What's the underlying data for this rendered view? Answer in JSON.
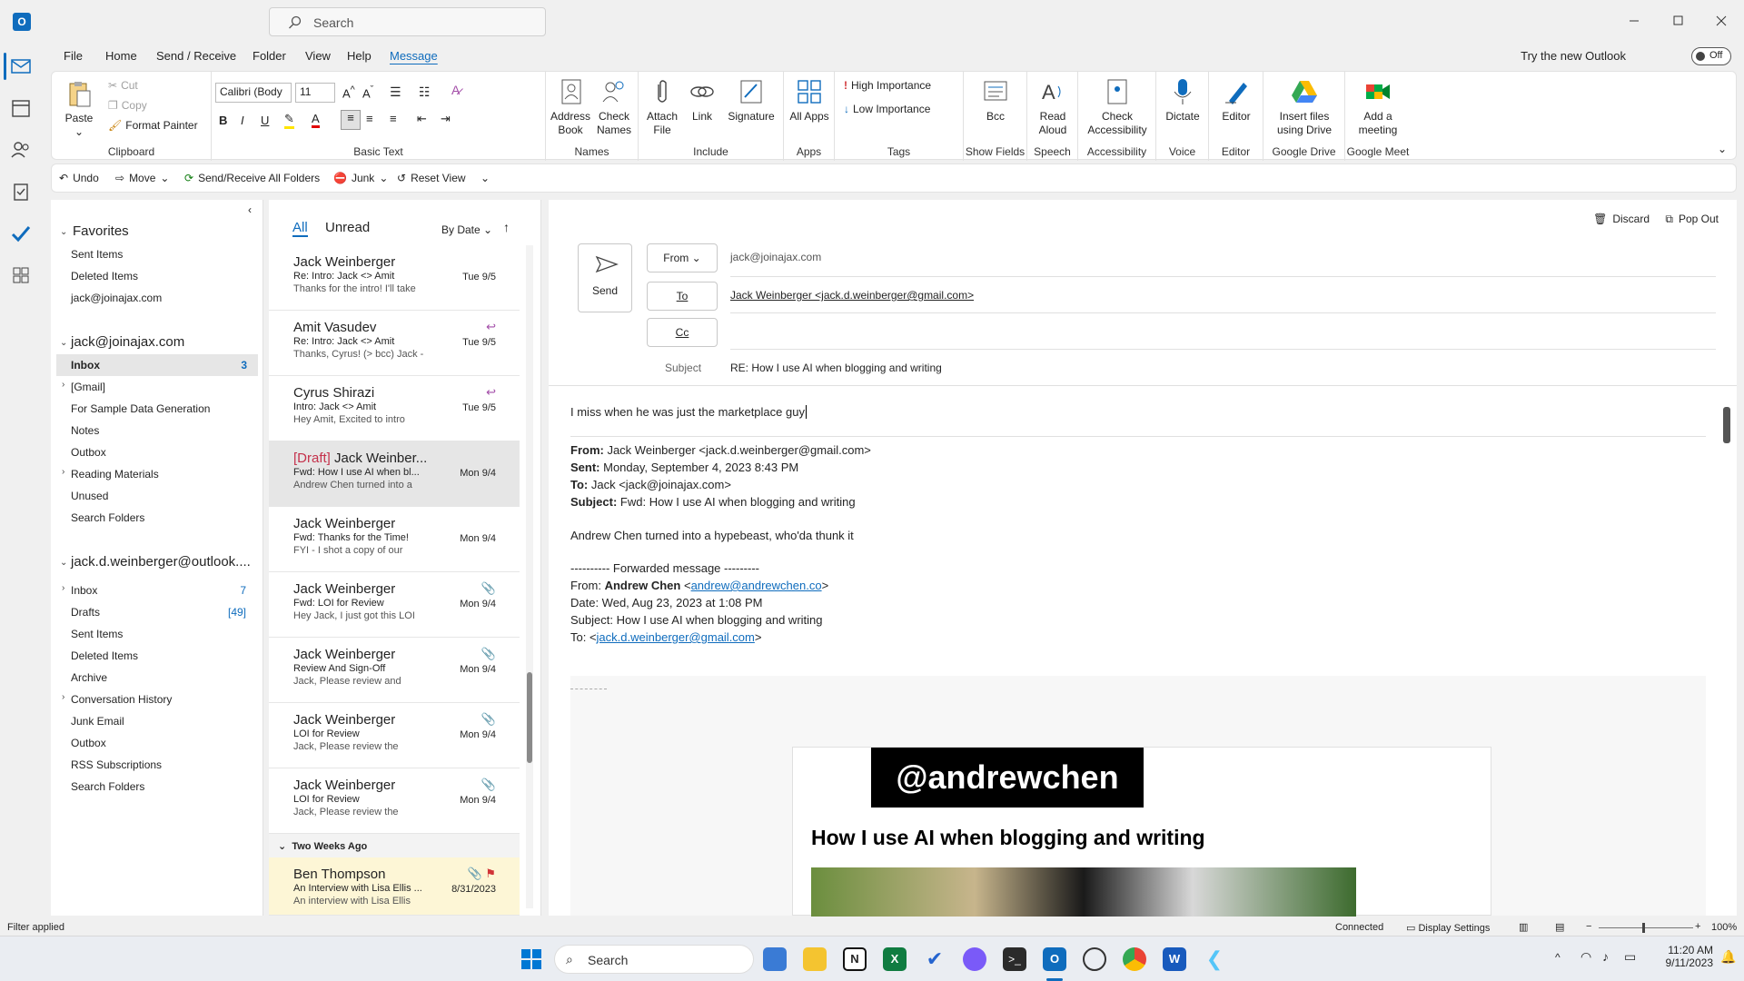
{
  "titlebar": {
    "app_initial": "O",
    "search_placeholder": "Search"
  },
  "menu": [
    "File",
    "Home",
    "Send / Receive",
    "Folder",
    "View",
    "Help",
    "Message"
  ],
  "try_new": "Try the new Outlook",
  "toggle_label": "Off",
  "ribbon": {
    "paste": "Paste",
    "cut": "Cut",
    "copy": "Copy",
    "format_painter": "Format Painter",
    "clipboard": "Clipboard",
    "font_name": "Calibri (Body",
    "font_size": "11",
    "basic_text": "Basic Text",
    "address_book": "Address Book",
    "check_names": "Check Names",
    "names": "Names",
    "attach_file": "Attach File",
    "link": "Link",
    "signature": "Signature",
    "include": "Include",
    "all_apps": "All Apps",
    "apps": "Apps",
    "high_importance": "High Importance",
    "low_importance": "Low Importance",
    "tags": "Tags",
    "bcc": "Bcc",
    "show_fields": "Show Fields",
    "read_aloud": "Read Aloud",
    "speech": "Speech",
    "check_accessibility": "Check Accessibility",
    "accessibility": "Accessibility",
    "dictate": "Dictate",
    "voice": "Voice",
    "editor_btn": "Editor",
    "editor_group": "Editor",
    "insert_drive": "Insert files using Drive",
    "google_drive": "Google Drive",
    "add_meeting": "Add a meeting",
    "google_meet": "Google Meet"
  },
  "quick": {
    "undo": "Undo",
    "move": "Move",
    "send_receive": "Send/Receive All Folders",
    "junk": "Junk",
    "reset_view": "Reset View"
  },
  "folders": {
    "favorites": "Favorites",
    "fav_items": [
      "Sent Items",
      "Deleted Items",
      "jack@joinajax.com"
    ],
    "account1": "jack@joinajax.com",
    "acct1_items": [
      {
        "label": "Inbox",
        "count": "3"
      },
      {
        "label": "[Gmail]",
        "count": ""
      },
      {
        "label": "For Sample Data Generation",
        "count": ""
      },
      {
        "label": "Notes",
        "count": ""
      },
      {
        "label": "Outbox",
        "count": ""
      },
      {
        "label": "Reading Materials",
        "count": ""
      },
      {
        "label": "Unused",
        "count": ""
      },
      {
        "label": "Search Folders",
        "count": ""
      }
    ],
    "account2": "jack.d.weinberger@outlook....",
    "acct2_items": [
      {
        "label": "Inbox",
        "count": "7"
      },
      {
        "label": "Drafts",
        "count": "[49]"
      },
      {
        "label": "Sent Items",
        "count": ""
      },
      {
        "label": "Deleted Items",
        "count": ""
      },
      {
        "label": "Archive",
        "count": ""
      },
      {
        "label": "Conversation History",
        "count": ""
      },
      {
        "label": "Junk Email",
        "count": ""
      },
      {
        "label": "Outbox",
        "count": ""
      },
      {
        "label": "RSS Subscriptions",
        "count": ""
      },
      {
        "label": "Search Folders",
        "count": ""
      }
    ]
  },
  "msglist": {
    "tab_all": "All",
    "tab_unread": "Unread",
    "sort": "By Date",
    "group_label": "Two Weeks Ago",
    "messages": [
      {
        "draft": "",
        "who": "Jack Weinberger",
        "subj": "Re: Intro: Jack <> Amit",
        "prev": "Thanks for the intro! I'll take",
        "date": "Tue 9/5"
      },
      {
        "draft": "",
        "who": "Amit Vasudev",
        "subj": "Re: Intro: Jack <> Amit",
        "prev": "Thanks, Cyrus! (> bcc)  Jack -",
        "date": "Tue 9/5"
      },
      {
        "draft": "",
        "who": "Cyrus Shirazi",
        "subj": "Intro: Jack <> Amit",
        "prev": "Hey Amit,  Excited to intro",
        "date": "Tue 9/5"
      },
      {
        "draft": "[Draft]",
        "who": " Jack Weinber...",
        "subj": "Fwd: How I use AI when bl...",
        "prev": "Andrew Chen turned into a",
        "date": "Mon 9/4"
      },
      {
        "draft": "",
        "who": "Jack Weinberger",
        "subj": "Fwd: Thanks for the Time!",
        "prev": "FYI - I shot a copy of our",
        "date": "Mon 9/4"
      },
      {
        "draft": "",
        "who": "Jack Weinberger",
        "subj": "Fwd: LOI for Review",
        "prev": "Hey Jack,  I just got this LOI",
        "date": "Mon 9/4"
      },
      {
        "draft": "",
        "who": "Jack Weinberger",
        "subj": "Review And Sign-Off",
        "prev": "Jack,  Please review and",
        "date": "Mon 9/4"
      },
      {
        "draft": "",
        "who": "Jack Weinberger",
        "subj": "LOI for Review",
        "prev": "Jack,  Please review the",
        "date": "Mon 9/4"
      },
      {
        "draft": "",
        "who": "Jack Weinberger",
        "subj": "LOI for Review",
        "prev": "Jack,  Please review the",
        "date": "Mon 9/4"
      }
    ],
    "ben": {
      "who": "Ben Thompson",
      "subj": "An Interview with Lisa Ellis ...",
      "prev": "An interview with Lisa Ellis",
      "date": "8/31/2023"
    }
  },
  "compose": {
    "discard": "Discard",
    "pop_out": "Pop Out",
    "send": "Send",
    "from_btn": "From",
    "from_value": "jack@joinajax.com",
    "to_btn": "To",
    "to_value": "Jack Weinberger <jack.d.weinberger@gmail.com>",
    "cc_btn": "Cc",
    "subject_label": "Subject",
    "subject_value": "RE: How I use AI when blogging and writing",
    "body_line": "I miss when he was just the marketplace guy",
    "quoted": {
      "from_label": "From:",
      "from": " Jack Weinberger <jack.d.weinberger@gmail.com>",
      "sent_label": "Sent:",
      "sent": " Monday, September 4, 2023 8:43 PM",
      "to_label": "To:",
      "to": " Jack <jack@joinajax.com>",
      "subject_label": "Subject:",
      "subject": " Fwd: How I use AI when blogging and writing",
      "comment": "Andrew Chen turned into a hypebeast, who'da thunk it",
      "fwd_header": "---------- Forwarded message ---------",
      "fwd_from_pre": "From: ",
      "fwd_from_name": "Andrew Chen",
      "fwd_from_lt": " <",
      "fwd_from_email": "andrew@andrewchen.co",
      "fwd_from_gt": ">",
      "fwd_date": "Date: Wed, Aug 23, 2023 at 1:08 PM",
      "fwd_subject": "Subject: How I use AI when blogging and writing",
      "fwd_to_pre": "To: <",
      "fwd_to_email": "jack.d.weinberger@gmail.com",
      "fwd_to_post": ">"
    },
    "newsletter_handle": "@andrewchen",
    "newsletter_title": "How I use AI when blogging and writing"
  },
  "status": {
    "filter": "Filter applied",
    "connected": "Connected",
    "display_settings": "Display Settings",
    "zoom": "100%"
  },
  "taskbar": {
    "search": "Search",
    "time": "11:20 AM",
    "date": "9/11/2023"
  }
}
